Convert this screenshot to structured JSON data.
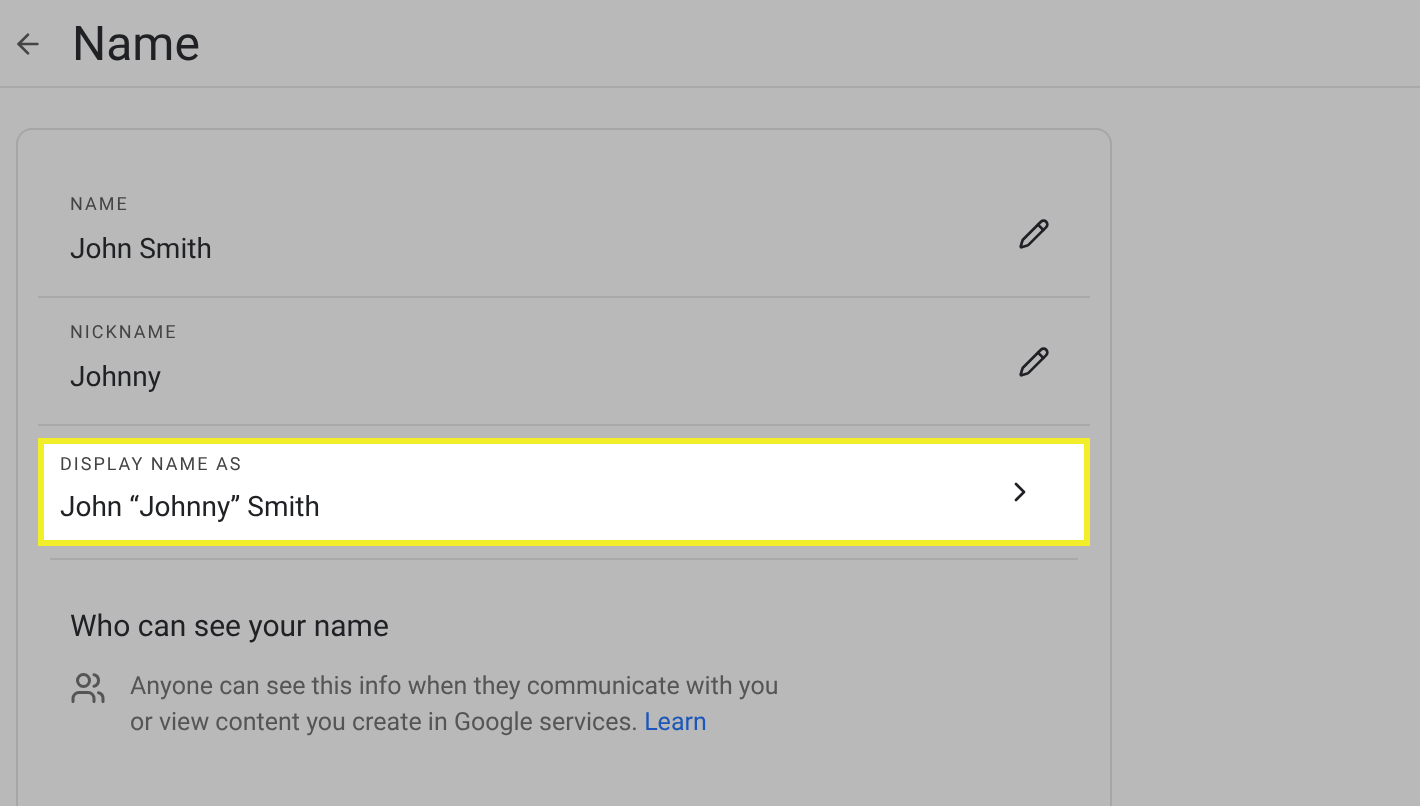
{
  "header": {
    "title": "Name"
  },
  "rows": [
    {
      "kind": "edit",
      "label": "NAME",
      "value": "John Smith",
      "selected": false
    },
    {
      "kind": "edit",
      "label": "NICKNAME",
      "value": "Johnny",
      "selected": false
    },
    {
      "kind": "link",
      "label": "DISPLAY NAME AS",
      "value": "John “Johnny” Smith",
      "selected": true
    }
  ],
  "visibility": {
    "heading": "Who can see your name",
    "text": "Anyone can see this info when they communicate with you or view content you create in Google services.",
    "link": "Learn"
  }
}
